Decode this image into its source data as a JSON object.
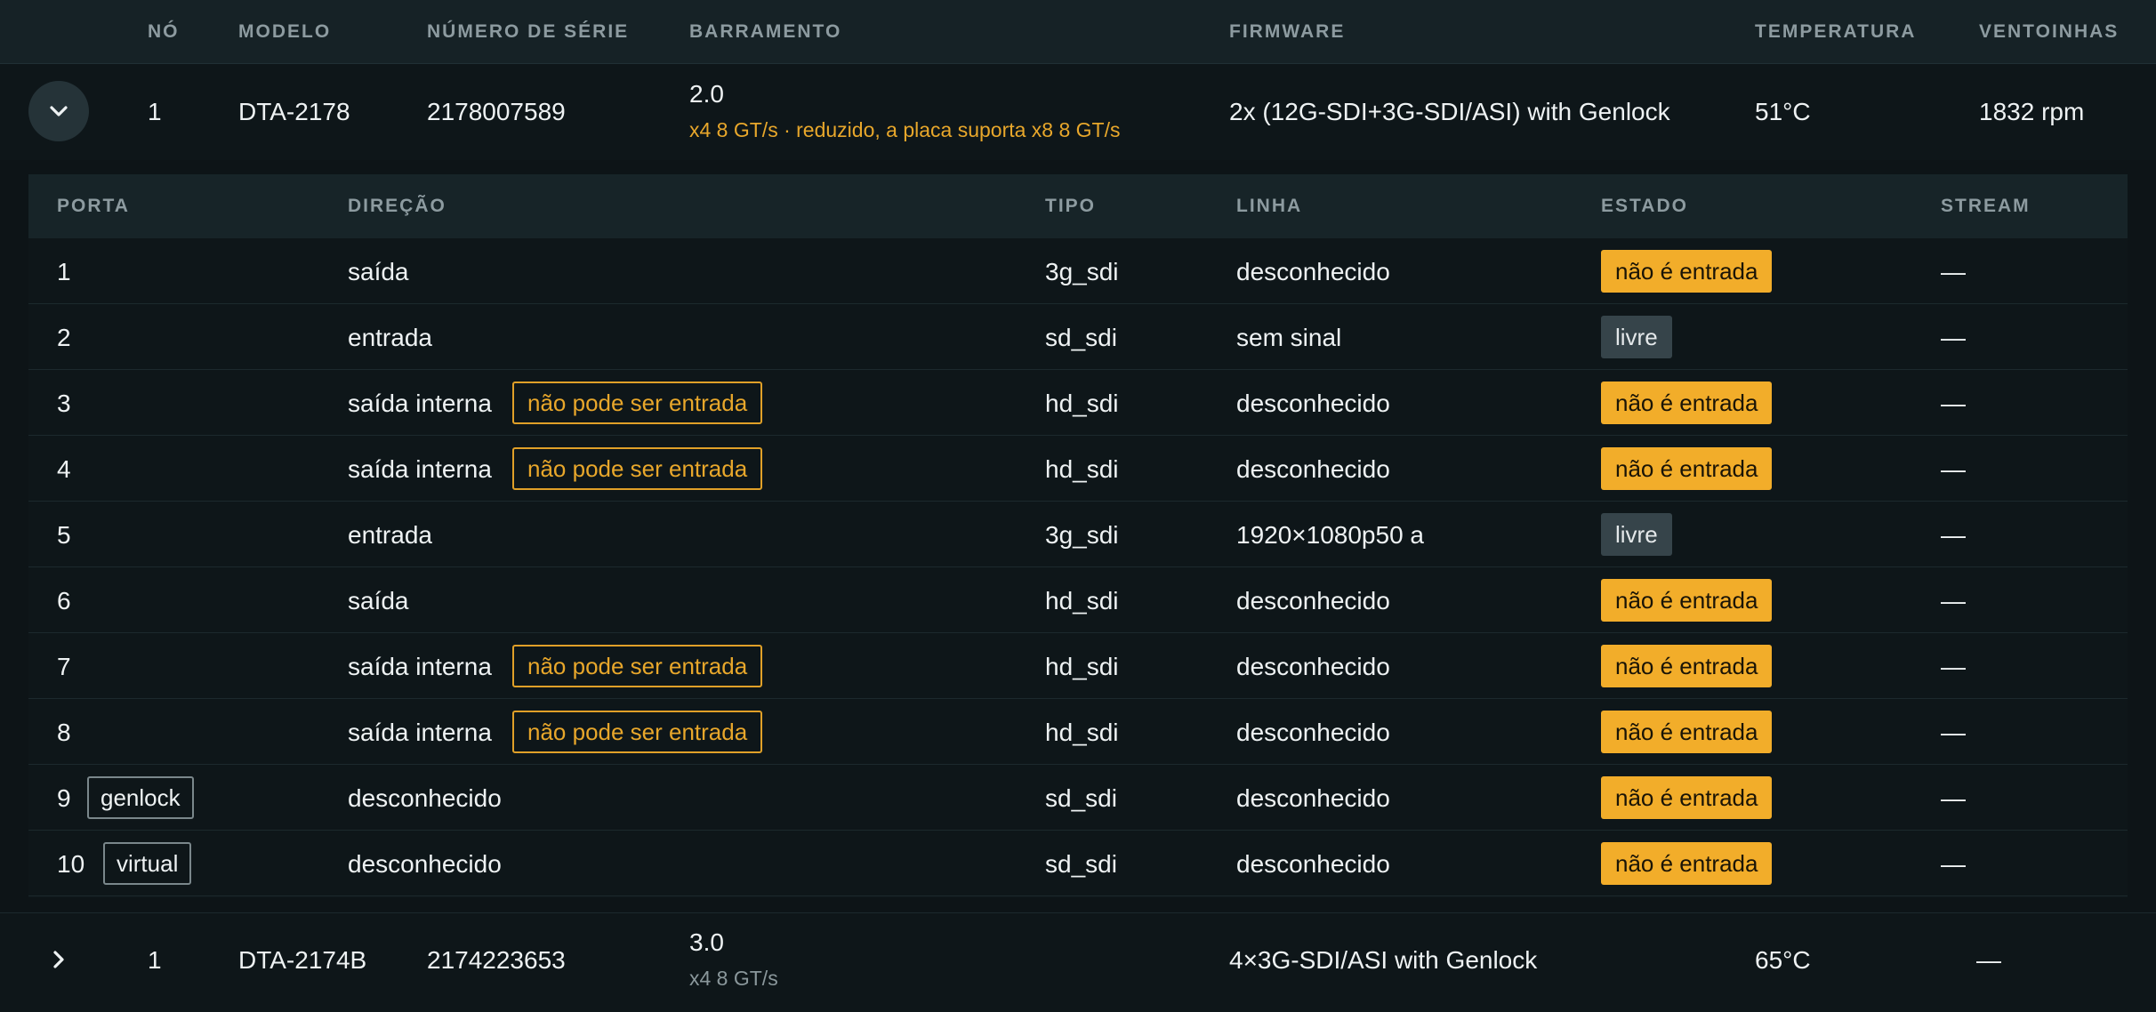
{
  "device_table": {
    "headers": {
      "node": "NÓ",
      "model": "MODELO",
      "serial": "NÚMERO DE SÉRIE",
      "bus": "BARRAMENTO",
      "firmware": "FIRMWARE",
      "temperature": "TEMPERATURA",
      "fans": "VENTOINHAS"
    },
    "devices": [
      {
        "expanded": true,
        "node": "1",
        "model": "DTA-2178",
        "serial": "2178007589",
        "bus": "2.0",
        "bus_detail": "x4 8 GT/s · reduzido, a placa suporta x8 8 GT/s",
        "firmware": "2x (12G-SDI+3G-SDI/ASI) with Genlock",
        "temperature": "51°C",
        "fans": "1832 rpm"
      },
      {
        "expanded": false,
        "node": "1",
        "model": "DTA-2174B",
        "serial": "2174223653",
        "bus": "3.0",
        "bus_detail": "x4 8 GT/s",
        "firmware": "4×3G-SDI/ASI with Genlock",
        "temperature": "65°C",
        "fans": "—"
      }
    ]
  },
  "ports_table": {
    "headers": {
      "port": "PORTA",
      "direction": "DIREÇÃO",
      "type": "TIPO",
      "line": "LINHA",
      "state": "ESTADO",
      "stream": "STREAM"
    },
    "rows": [
      {
        "port": "1",
        "port_tag": "",
        "direction": "saída",
        "direction_tag": "",
        "type": "3g_sdi",
        "line": "desconhecido",
        "state": "não é entrada",
        "state_kind": "warn",
        "stream": "—"
      },
      {
        "port": "2",
        "port_tag": "",
        "direction": "entrada",
        "direction_tag": "",
        "type": "sd_sdi",
        "line": "sem sinal",
        "state": "livre",
        "state_kind": "free",
        "stream": "—"
      },
      {
        "port": "3",
        "port_tag": "",
        "direction": "saída interna",
        "direction_tag": "não pode ser entrada",
        "type": "hd_sdi",
        "line": "desconhecido",
        "state": "não é entrada",
        "state_kind": "warn",
        "stream": "—"
      },
      {
        "port": "4",
        "port_tag": "",
        "direction": "saída interna",
        "direction_tag": "não pode ser entrada",
        "type": "hd_sdi",
        "line": "desconhecido",
        "state": "não é entrada",
        "state_kind": "warn",
        "stream": "—"
      },
      {
        "port": "5",
        "port_tag": "",
        "direction": "entrada",
        "direction_tag": "",
        "type": "3g_sdi",
        "line": "1920×1080p50 a",
        "state": "livre",
        "state_kind": "free",
        "stream": "—"
      },
      {
        "port": "6",
        "port_tag": "",
        "direction": "saída",
        "direction_tag": "",
        "type": "hd_sdi",
        "line": "desconhecido",
        "state": "não é entrada",
        "state_kind": "warn",
        "stream": "—"
      },
      {
        "port": "7",
        "port_tag": "",
        "direction": "saída interna",
        "direction_tag": "não pode ser entrada",
        "type": "hd_sdi",
        "line": "desconhecido",
        "state": "não é entrada",
        "state_kind": "warn",
        "stream": "—"
      },
      {
        "port": "8",
        "port_tag": "",
        "direction": "saída interna",
        "direction_tag": "não pode ser entrada",
        "type": "hd_sdi",
        "line": "desconhecido",
        "state": "não é entrada",
        "state_kind": "warn",
        "stream": "—"
      },
      {
        "port": "9",
        "port_tag": "genlock",
        "direction": "desconhecido",
        "direction_tag": "",
        "type": "sd_sdi",
        "line": "desconhecido",
        "state": "não é entrada",
        "state_kind": "warn",
        "stream": "—"
      },
      {
        "port": "10",
        "port_tag": "virtual",
        "direction": "desconhecido",
        "direction_tag": "",
        "type": "sd_sdi",
        "line": "desconhecido",
        "state": "não é entrada",
        "state_kind": "warn",
        "stream": "—"
      }
    ]
  },
  "icons": {
    "expand_toggle_open": "chevron-down-icon",
    "expand_toggle_closed": "chevron-right-icon"
  },
  "colors": {
    "warning": "#f2ad2a",
    "free_badge": "#36444a",
    "background": "#0d1417",
    "header_bg": "#162226"
  }
}
